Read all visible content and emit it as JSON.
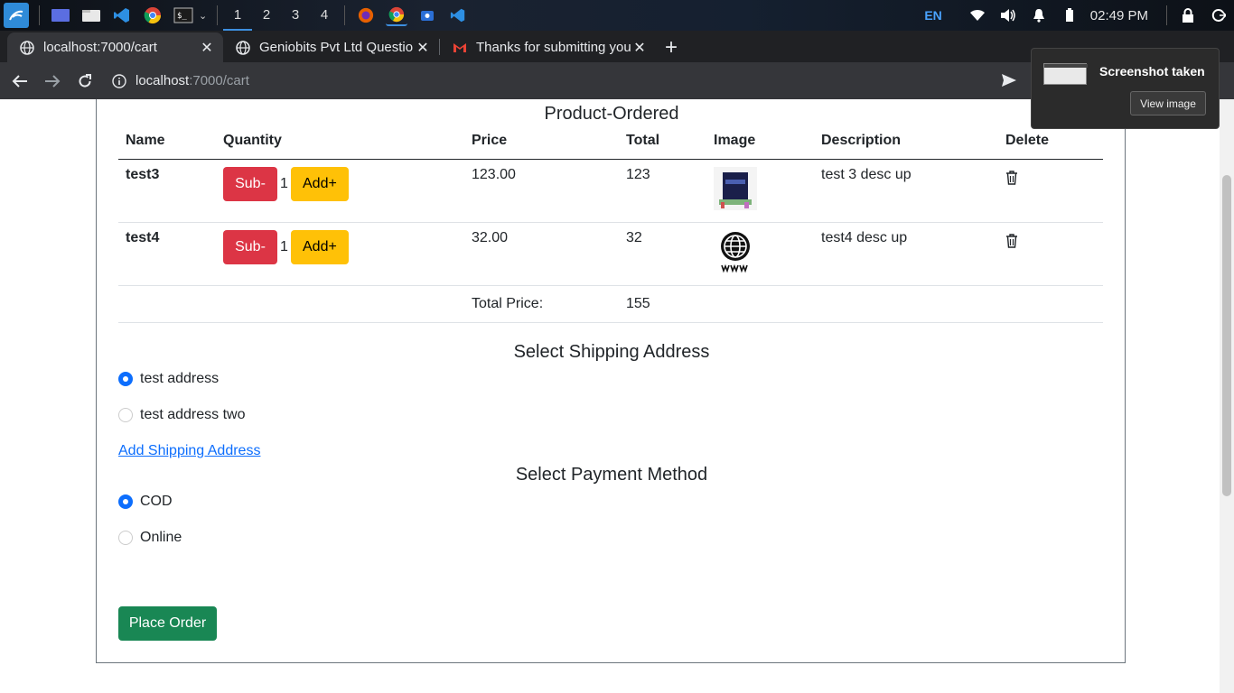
{
  "taskbar": {
    "workspaces": [
      "1",
      "2",
      "3",
      "4"
    ],
    "language": "EN",
    "clock": "02:49 PM"
  },
  "tabs": [
    {
      "title": "localhost:7000/cart",
      "close": "✕"
    },
    {
      "title": "Geniobits Pvt Ltd Questio",
      "close": "✕"
    },
    {
      "title": "Thanks for submitting you",
      "close": "✕"
    }
  ],
  "new_tab": "+",
  "address_bar": {
    "host": "localhost",
    "path": ":7000/cart"
  },
  "cart": {
    "title": "Product-Ordered",
    "headers": [
      "Name",
      "Quantity",
      "Price",
      "Total",
      "Image",
      "Description",
      "Delete"
    ],
    "sub_label": "Sub-",
    "add_label": "Add+",
    "items": [
      {
        "name": "test3",
        "qty": "1",
        "price": "123.00",
        "total": "123",
        "image": "book-cover-thumbnail",
        "description": "test 3 desc up"
      },
      {
        "name": "test4",
        "qty": "1",
        "price": "32.00",
        "total": "32",
        "image": "www-globe-icon",
        "description": "test4 desc up"
      }
    ],
    "total_label": "Total Price:",
    "total_value": "155"
  },
  "shipping": {
    "title": "Select Shipping Address",
    "options": [
      "test address",
      "test address two"
    ],
    "selected": 0,
    "add_link": "Add Shipping Address"
  },
  "payment": {
    "title": "Select Payment Method",
    "options": [
      "COD",
      "Online"
    ],
    "selected": 0
  },
  "place_order": "Place Order",
  "notification": {
    "title": "Screenshot taken",
    "button": "View image"
  },
  "colors": {
    "danger": "#dc3545",
    "warning": "#ffc107",
    "success": "#198754",
    "primary": "#0d6efd"
  }
}
